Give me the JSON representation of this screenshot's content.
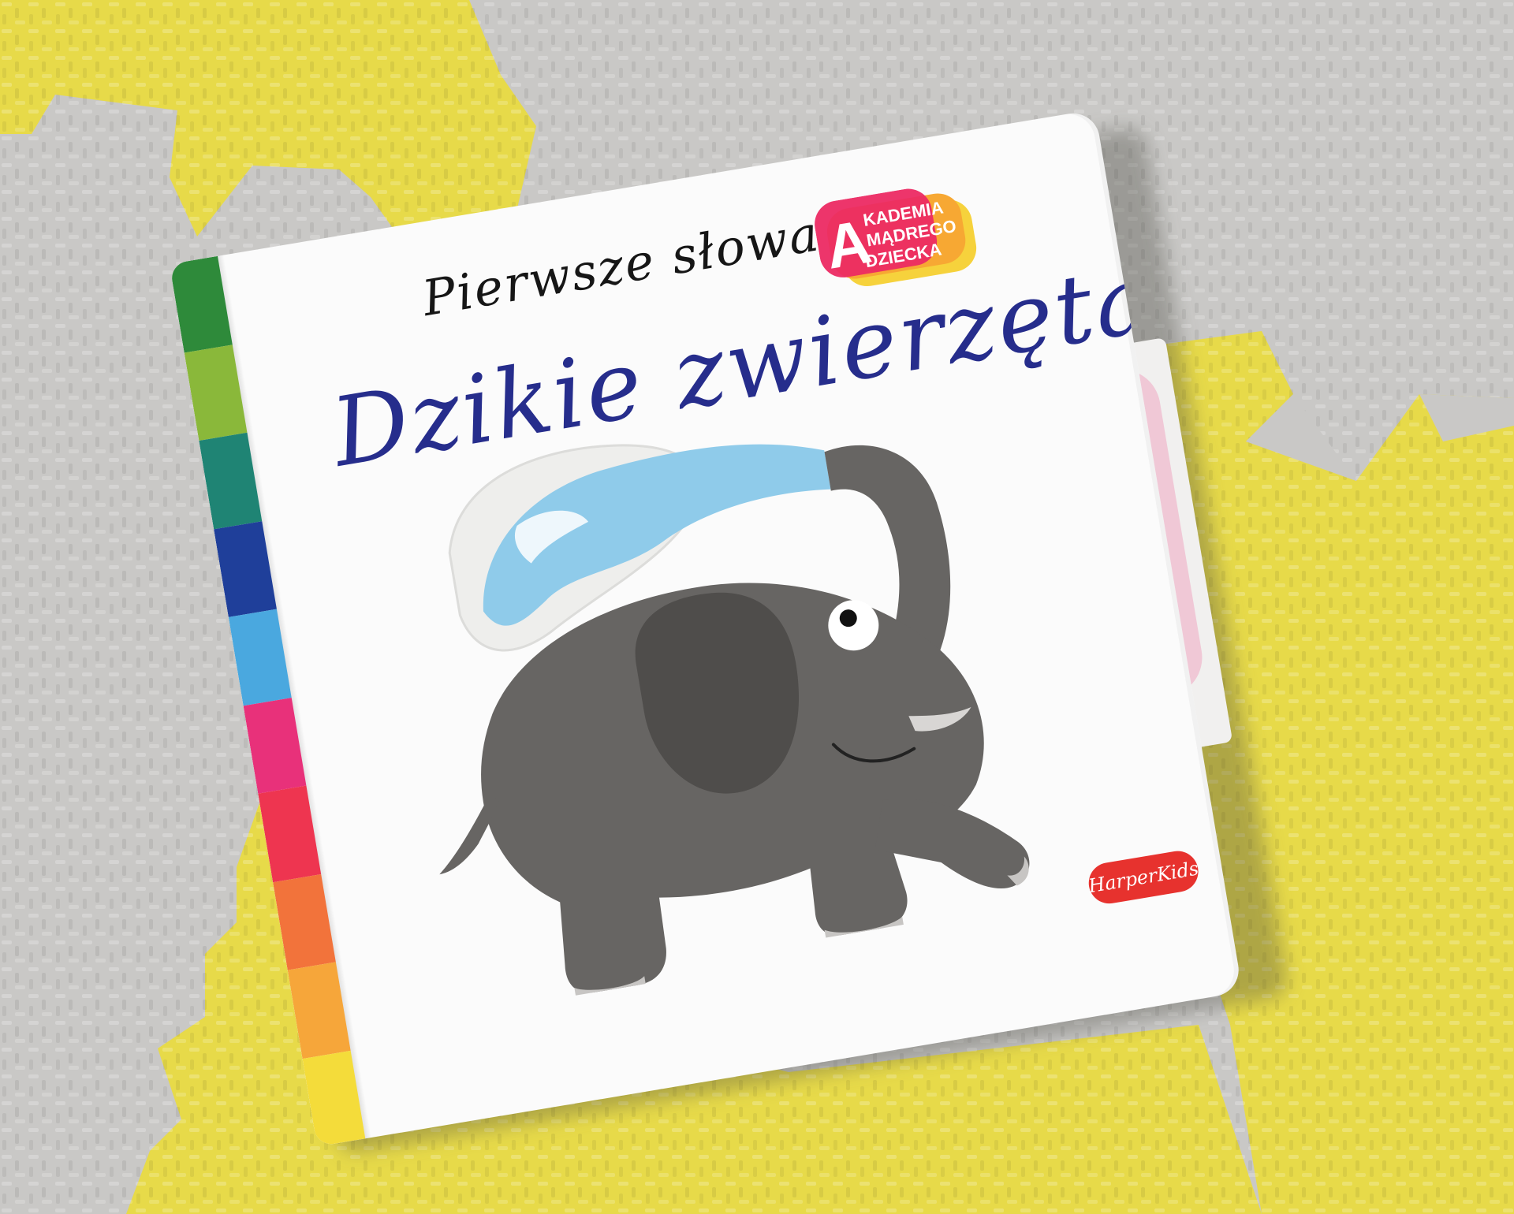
{
  "book": {
    "subtitle": "Pierwsze słowa",
    "title": "Dzikie zwierzęta",
    "publisher": "HarperKids",
    "series_logo": {
      "big_letter": "A",
      "line1": "KADEMIA",
      "line2": "MĄDREGO",
      "line3": "DZIECKA",
      "colors": [
        "#ec2a63",
        "#f7a833",
        "#f6d23c"
      ]
    },
    "spine_colors": [
      "#2e8a3a",
      "#8ab83a",
      "#1f8474",
      "#1f3f9a",
      "#4aa8df",
      "#e8317a",
      "#ee3550",
      "#f2733b",
      "#f6a63a",
      "#f4dc3a"
    ]
  },
  "scene": {
    "mat_colors": {
      "gray": "#c9c8c6",
      "yellow": "#e7da49"
    },
    "elephant_color": "#676563",
    "water_color": "#8fcbea"
  }
}
